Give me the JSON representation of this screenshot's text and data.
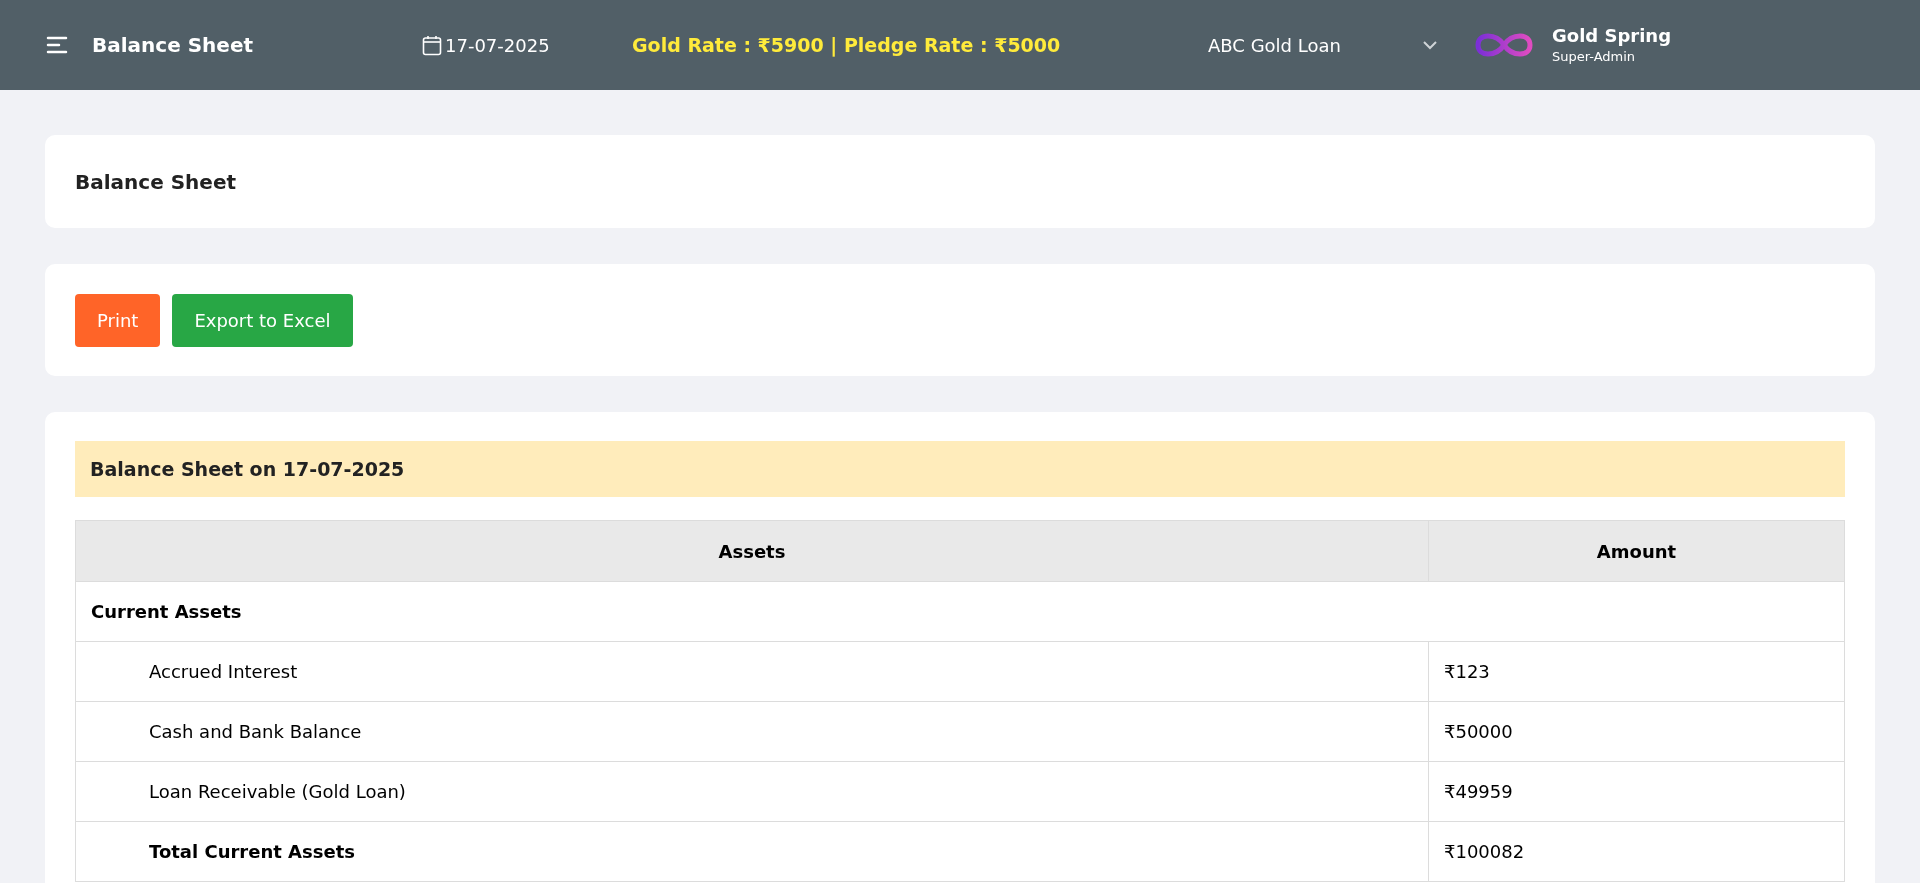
{
  "header": {
    "title": "Balance Sheet",
    "date": "17-07-2025",
    "rates": "Gold Rate : ₹5900 | Pledge Rate : ₹5000",
    "company": "ABC Gold Loan",
    "user": {
      "name": "Gold Spring",
      "role": "Super-Admin"
    }
  },
  "page_title": "Balance Sheet",
  "buttons": [
    {
      "label": "Print",
      "kind": "print"
    },
    {
      "label": "Export to Excel",
      "kind": "excel"
    }
  ],
  "report": {
    "title": "Balance Sheet on 17-07-2025",
    "columns": [
      "Assets",
      "Amount"
    ],
    "rows": [
      {
        "kind": "section",
        "label": "Current Assets"
      },
      {
        "kind": "item",
        "label": "Accrued Interest",
        "amount": "₹123"
      },
      {
        "kind": "item",
        "label": "Cash and Bank Balance",
        "amount": "₹50000"
      },
      {
        "kind": "item",
        "label": "Loan Receivable (Gold Loan)",
        "amount": "₹49959"
      },
      {
        "kind": "total",
        "label": "Total Current Assets",
        "amount": "₹100082"
      }
    ]
  }
}
